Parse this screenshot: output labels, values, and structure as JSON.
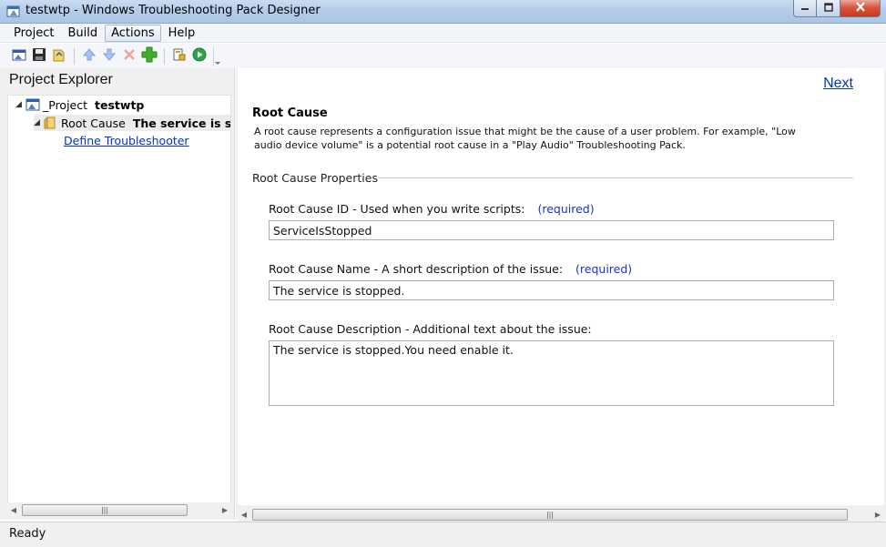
{
  "window": {
    "title": "testwtp - Windows Troubleshooting Pack Designer",
    "app_icon": "wtp-designer-icon",
    "minimize_icon": "minimize-icon",
    "maximize_icon": "maximize-icon",
    "close_icon": "close-icon"
  },
  "menu": {
    "items": [
      "Project",
      "Build",
      "Actions",
      "Help"
    ],
    "active": "Actions"
  },
  "toolbar": {
    "buttons": [
      "new-project-icon",
      "save-icon",
      "open-icon",
      "move-up-icon",
      "move-down-icon",
      "delete-icon",
      "add-icon",
      "build-icon",
      "run-icon"
    ]
  },
  "explorer": {
    "title": "Project Explorer",
    "project_label": "_Project",
    "project_name": "testwtp",
    "root_cause_label": "Root Cause",
    "root_cause_name": "The service is stop",
    "link": "Define Troubleshooter"
  },
  "main": {
    "next_link": "Next",
    "section_title": "Root Cause",
    "section_desc": "A root cause represents a configuration issue that might be the cause of a user problem. For example, \"Low audio device volume\" is a potential root cause in a \"Play Audio\" Troubleshooting Pack.",
    "group_title": "Root Cause Properties",
    "fields": {
      "id_label": "Root Cause ID - Used when you write scripts:",
      "id_required": "(required)",
      "id_value": "ServiceIsStopped",
      "name_label": "Root Cause Name - A short description of the issue:",
      "name_required": "(required)",
      "name_value": "The service is stopped.",
      "desc_label": "Root Cause Description - Additional text about the issue:",
      "desc_value": "The service is stopped.You need enable it."
    }
  },
  "status": {
    "text": "Ready"
  },
  "colors": {
    "link": "#0033cc",
    "title_bar": "#b5cde9",
    "close_button": "#c4391c"
  }
}
